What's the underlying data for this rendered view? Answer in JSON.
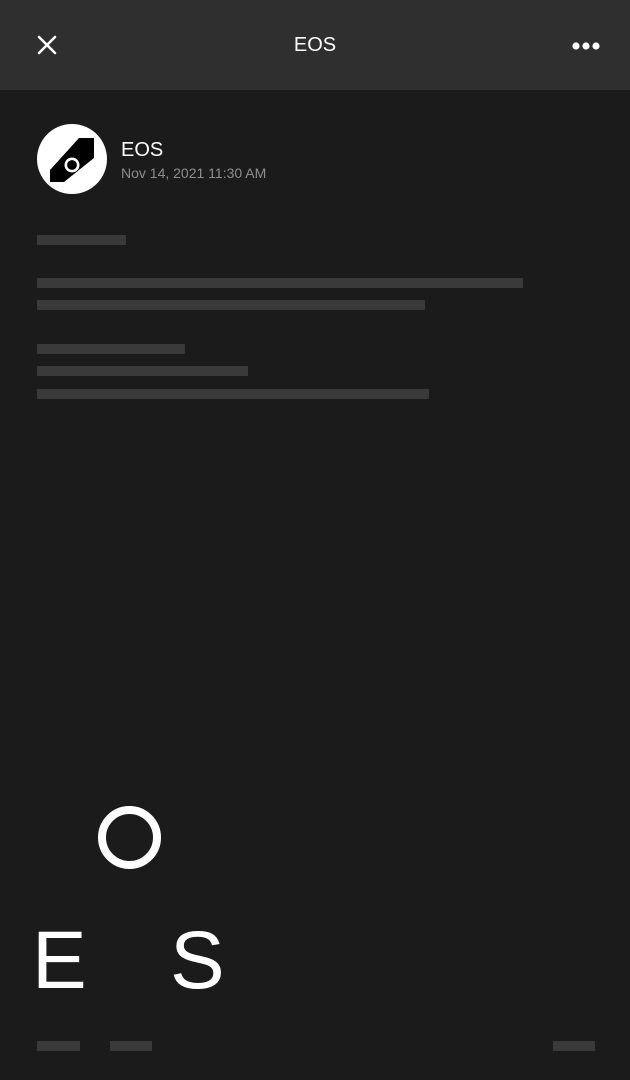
{
  "nav": {
    "title": "EOS",
    "close_icon": "close-icon",
    "more_icon": "more-horizontal-icon"
  },
  "post": {
    "author_name": "EOS",
    "timestamp": "Nov 14, 2021 11:30 AM",
    "avatar_icon": "eos-logo-icon"
  },
  "cover": {
    "letter_o": "O",
    "letter_e": "E",
    "letter_s": "S"
  },
  "colors": {
    "background": "#1b1b1b",
    "nav_background": "#2f2f2f",
    "skeleton": "#3a3a3a",
    "secondary_text": "#8e8e8e"
  }
}
